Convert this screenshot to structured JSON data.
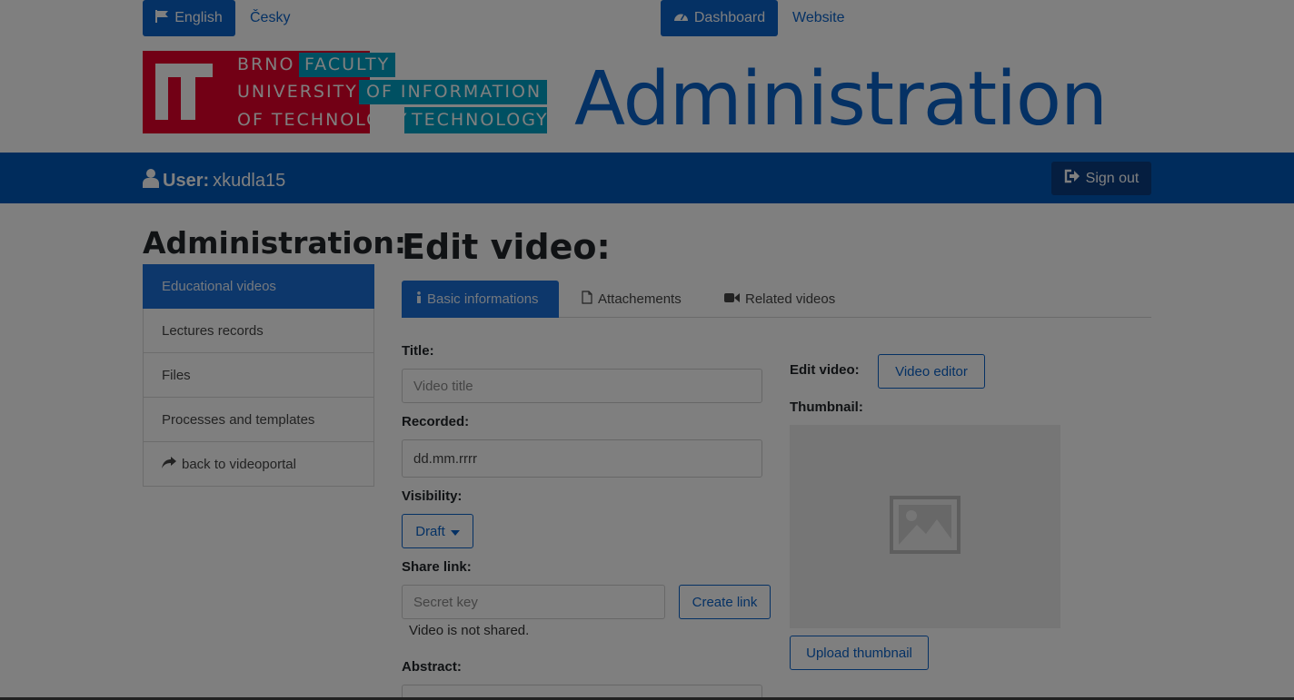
{
  "topbar": {
    "lang_en": "English",
    "lang_cs": "Česky",
    "dashboard": "Dashboard",
    "website": "Website"
  },
  "logo": {
    "line1_red": "BRNO",
    "line2_red": "UNIVERSITY",
    "line3_red": "OF TECHNOLOGY",
    "line1_cyan": "FACULTY",
    "line2_cyan": "OF INFORMATION",
    "line3_cyan": "TECHNOLOGY"
  },
  "header": {
    "title": "Administration"
  },
  "userbar": {
    "user_prefix": "User:",
    "username": "xkudla15",
    "sign_out": "Sign out"
  },
  "sidebar": {
    "title": "Administration:",
    "items": [
      {
        "label": "Educational videos",
        "active": true
      },
      {
        "label": "Lectures records"
      },
      {
        "label": "Files"
      },
      {
        "label": "Processes and templates"
      },
      {
        "label": "back to videoportal",
        "icon": "share-arrow-icon"
      }
    ]
  },
  "main": {
    "title": "Edit video:",
    "tabs": [
      {
        "label": "Basic informations",
        "icon": "info-icon",
        "active": true
      },
      {
        "label": "Attachements",
        "icon": "file-icon"
      },
      {
        "label": "Related videos",
        "icon": "video-camera-icon"
      }
    ],
    "form": {
      "title_label": "Title:",
      "title_placeholder": "Video title",
      "recorded_label": "Recorded:",
      "recorded_value": "dd.mm.rrrr",
      "visibility_label": "Visibility:",
      "visibility_value": "Draft",
      "share_label": "Share link:",
      "share_placeholder": "Secret key",
      "create_link": "Create link",
      "share_status": "Video is not shared.",
      "abstract_label": "Abstract:",
      "edit_video_label": "Edit video:",
      "video_editor": "Video editor",
      "thumbnail_label": "Thumbnail:",
      "upload_thumbnail": "Upload thumbnail"
    }
  },
  "colors": {
    "primary": "#0a62c9",
    "userbar": "#0059b8",
    "logo_red": "#e4002b",
    "logo_cyan": "#00a1c4"
  }
}
